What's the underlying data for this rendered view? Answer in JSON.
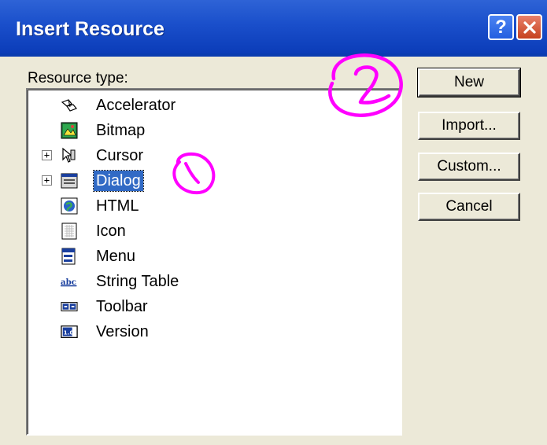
{
  "window": {
    "title": "Insert Resource"
  },
  "resource_type_label": "Resource type:",
  "resources": [
    {
      "label": "Accelerator",
      "icon": "accelerator-icon",
      "expandable": false,
      "selected": false
    },
    {
      "label": "Bitmap",
      "icon": "bitmap-icon",
      "expandable": false,
      "selected": false
    },
    {
      "label": "Cursor",
      "icon": "cursor-icon",
      "expandable": true,
      "selected": false
    },
    {
      "label": "Dialog",
      "icon": "dialog-icon",
      "expandable": true,
      "selected": true
    },
    {
      "label": "HTML",
      "icon": "html-icon",
      "expandable": false,
      "selected": false
    },
    {
      "label": "Icon",
      "icon": "icon-resource-icon",
      "expandable": false,
      "selected": false
    },
    {
      "label": "Menu",
      "icon": "menu-icon",
      "expandable": false,
      "selected": false
    },
    {
      "label": "String Table",
      "icon": "string-table-icon",
      "expandable": false,
      "selected": false
    },
    {
      "label": "Toolbar",
      "icon": "toolbar-icon",
      "expandable": false,
      "selected": false
    },
    {
      "label": "Version",
      "icon": "version-icon",
      "expandable": false,
      "selected": false
    }
  ],
  "icon_text": {
    "string_table": "abc",
    "version": "1.0"
  },
  "buttons": {
    "new": "New",
    "import": "Import...",
    "custom": "Custom...",
    "cancel": "Cancel"
  },
  "colors": {
    "titlebar": "#1A4FCB",
    "selection": "#316AC5",
    "annotation": "#FF00FF",
    "dialog_bg": "#ECE9D8"
  }
}
